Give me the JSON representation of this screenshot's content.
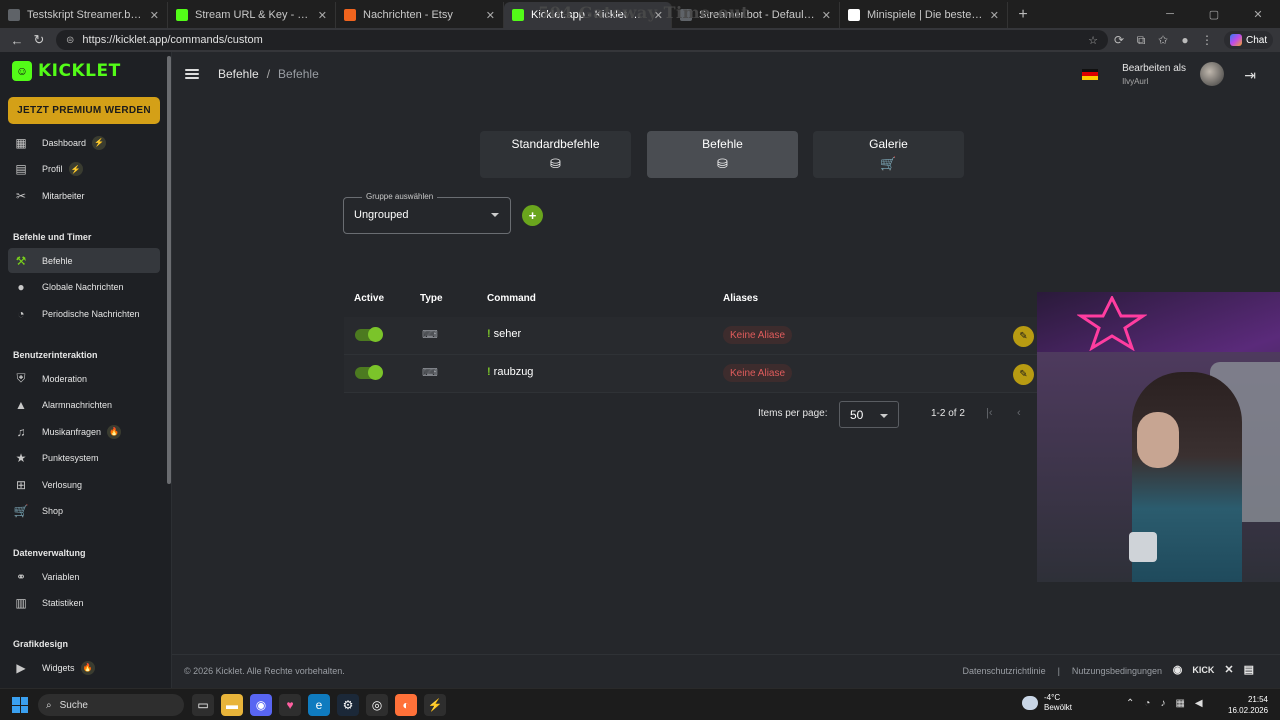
{
  "browser": {
    "overlay_title": "504 Gateway Time-out",
    "tabs": [
      {
        "title": "Testskript Streamer.bot Kick",
        "color": "#5f6368",
        "active": false
      },
      {
        "title": "Stream URL & Key - Kick Dashboard",
        "color": "#53fc18",
        "active": false
      },
      {
        "title": "Nachrichten - Etsy",
        "color": "#f1641e",
        "active": false
      },
      {
        "title": "Kicklet.app - Kicklet Befehle",
        "color": "#53fc18",
        "active": true
      },
      {
        "title": "Streamer.bot - Default commands",
        "color": "#5f6368",
        "active": false
      },
      {
        "title": "Minispiele | Die beste Software zur",
        "color": "#ffffff",
        "active": false
      }
    ],
    "url": "https://kicklet.app/commands/custom",
    "chat_label": "Chat"
  },
  "sidebar": {
    "logo_text": "KICKLET",
    "premium_label": "JETZT PREMIUM WERDEN",
    "items_top": [
      {
        "label": "Dashboard",
        "icon": "grid-icon",
        "badge": "⚡"
      },
      {
        "label": "Profil",
        "icon": "profile-icon",
        "badge": "⚡"
      },
      {
        "label": "Mitarbeiter",
        "icon": "tools-icon",
        "badge": ""
      }
    ],
    "section_commands": "Befehle und Timer",
    "items_commands": [
      {
        "label": "Befehle",
        "icon": "hammer-icon",
        "active": true
      },
      {
        "label": "Globale Nachrichten",
        "icon": "chat-icon"
      },
      {
        "label": "Periodische Nachrichten",
        "icon": "clock-icon"
      }
    ],
    "section_interaction": "Benutzerinteraktion",
    "items_interaction": [
      {
        "label": "Moderation",
        "icon": "shield-icon",
        "badge": ""
      },
      {
        "label": "Alarmnachrichten",
        "icon": "warning-icon",
        "badge": ""
      },
      {
        "label": "Musikanfragen",
        "icon": "music-icon",
        "badge": "🔥"
      },
      {
        "label": "Punktesystem",
        "icon": "star-icon",
        "badge": ""
      },
      {
        "label": "Verlosung",
        "icon": "gift-icon",
        "badge": ""
      },
      {
        "label": "Shop",
        "icon": "cart-icon",
        "badge": ""
      }
    ],
    "section_data": "Datenverwaltung",
    "items_data": [
      {
        "label": "Variablen",
        "icon": "link-icon"
      },
      {
        "label": "Statistiken",
        "icon": "chart-icon"
      }
    ],
    "section_graphics": "Grafikdesign",
    "items_graphics": [
      {
        "label": "Widgets",
        "icon": "video-icon",
        "badge": "🔥"
      }
    ]
  },
  "header": {
    "breadcrumb_root": "Befehle",
    "breadcrumb_separator": "/",
    "breadcrumb_current": "Befehle",
    "edit_as_label": "Bearbeiten als",
    "username": "IlvyAurl"
  },
  "tabs": [
    {
      "label": "Standardbefehle",
      "selected": false
    },
    {
      "label": "Befehle",
      "selected": true
    },
    {
      "label": "Galerie",
      "selected": false
    }
  ],
  "group_select": {
    "legend": "Gruppe auswählen",
    "value": "Ungrouped"
  },
  "table": {
    "columns": [
      "Active",
      "Type",
      "Command",
      "Aliases"
    ],
    "rows": [
      {
        "active": true,
        "command": "seher",
        "alias": "Keine Aliase"
      },
      {
        "active": true,
        "command": "raubzug",
        "alias": "Keine Aliase"
      }
    ]
  },
  "pagination": {
    "items_per_page_label": "Items per page:",
    "items_per_page": "50",
    "range": "1-2 of 2"
  },
  "footer": {
    "copyright": "© 2026 Kicklet. Alle Rechte vorbehalten.",
    "privacy": "Datenschutzrichtlinie",
    "divider": "|",
    "terms": "Nutzungsbedingungen",
    "kick_label": "KICK"
  },
  "taskbar": {
    "search_label": "Suche",
    "weather_temp": "-4°C",
    "weather_desc": "Bewölkt",
    "time": "21:54",
    "date": "16.02.2026"
  },
  "colors": {
    "brand": "#53fc18",
    "premium": "#d4a017",
    "toggle_on": "#7bc42a",
    "alias_text": "#e05c5c"
  }
}
